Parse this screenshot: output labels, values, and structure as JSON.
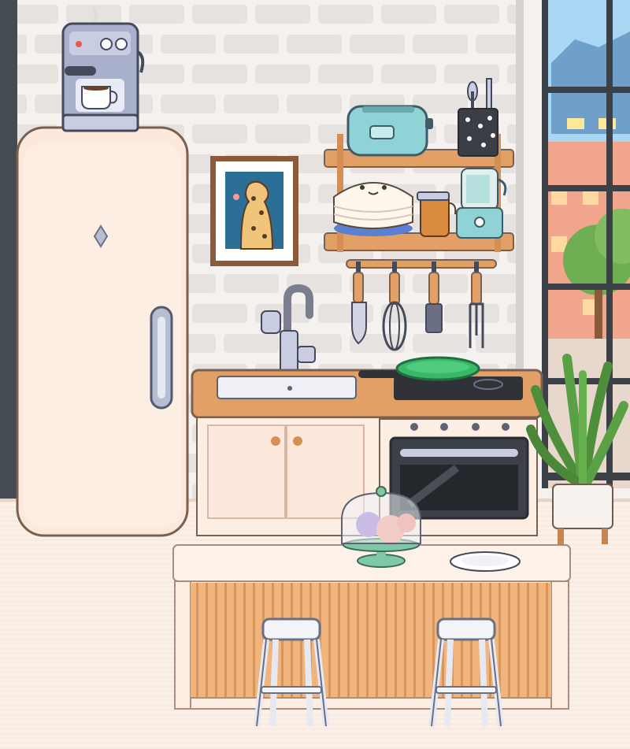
{
  "scene": {
    "name": "kitchen-room",
    "colors": {
      "wall": "#f4f1ef",
      "brick": "#e6e2e0",
      "floor": "#fbf1ea",
      "wood": "#e3a066",
      "cream": "#fdeee3",
      "outline": "#7a6050",
      "sky": "#a9d6f2",
      "window_frame": "#3c4148",
      "pan_green": "#39b86a",
      "toaster": "#8fd3d6",
      "plant": "#4e8f3b"
    },
    "icons": [
      "coffee-machine-icon",
      "refrigerator-icon",
      "picture-frame-icon",
      "toaster-icon",
      "utensil-holder-icon",
      "cake-icon",
      "syrup-jar-icon",
      "blender-icon",
      "knife-icon",
      "whisk-icon",
      "spatula-icon",
      "fork-icon",
      "faucet-icon",
      "sink-icon",
      "frying-pan-icon",
      "oven-icon",
      "fruit-dome-icon",
      "plate-icon",
      "potted-plant-icon",
      "bar-stool-icon"
    ]
  }
}
